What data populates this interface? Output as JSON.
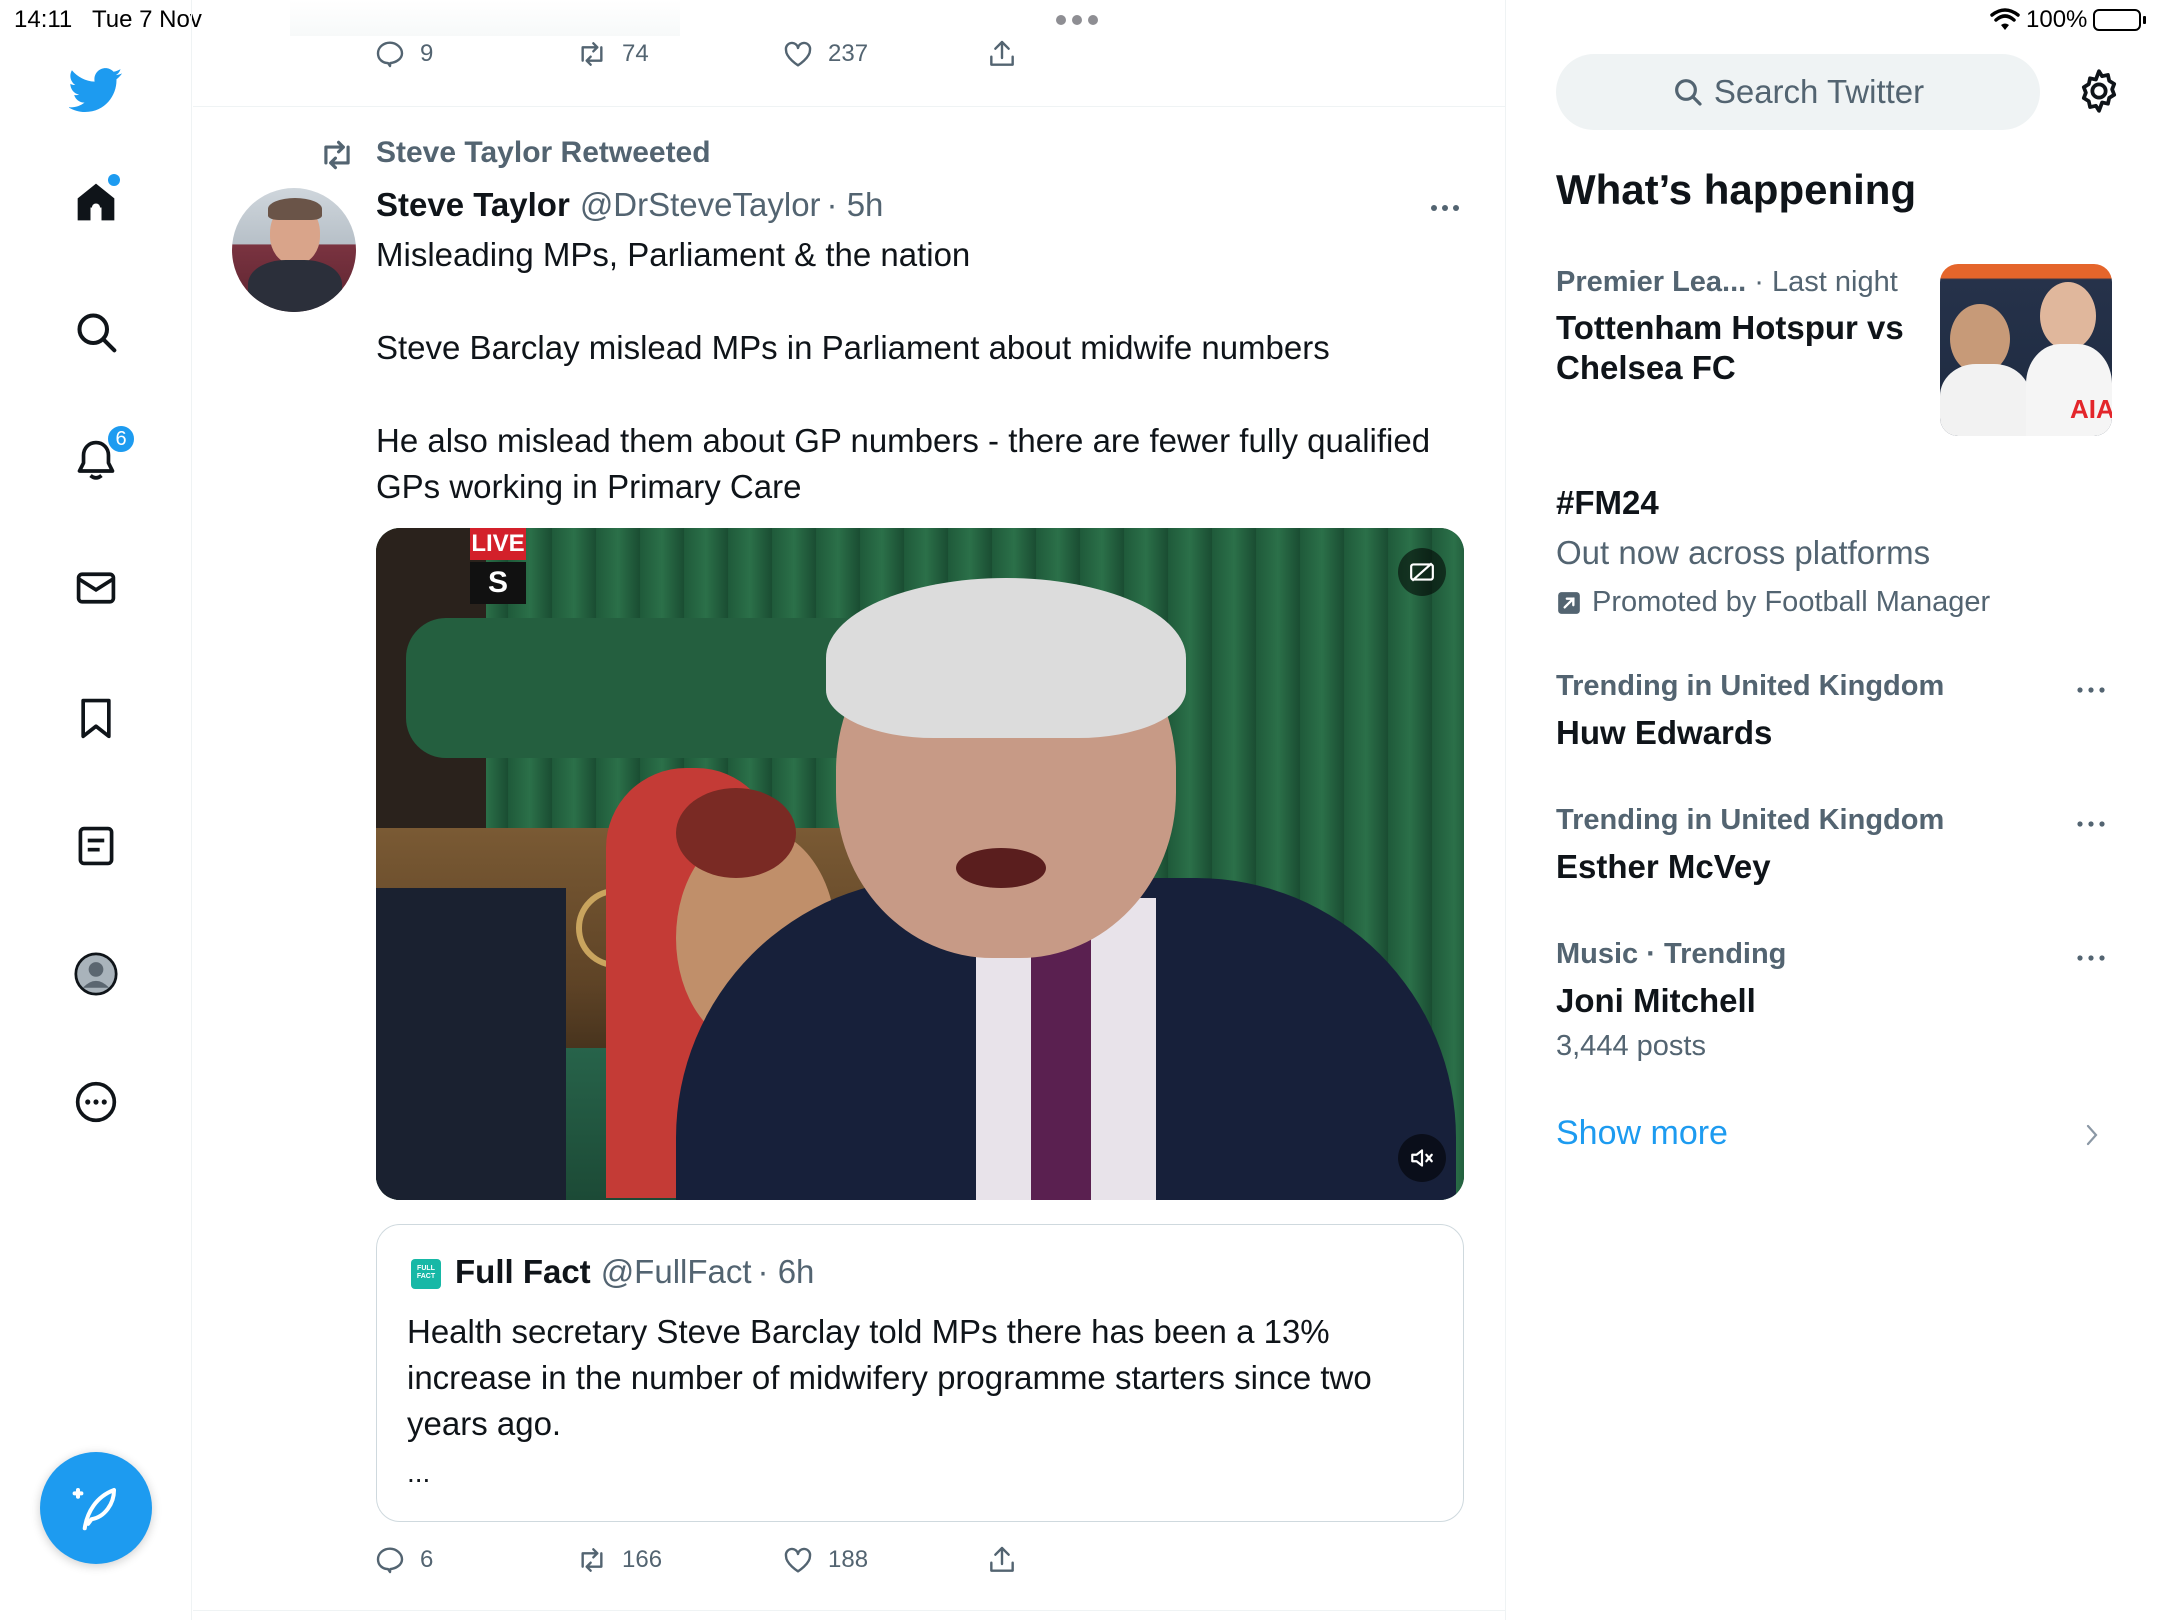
{
  "status_bar": {
    "time": "14:11",
    "date": "Tue 7 Nov",
    "battery": "100%",
    "battery_level": 1.0
  },
  "nav": {
    "notifications_badge": "6",
    "colors": {
      "brand": "#1d9bf0"
    }
  },
  "previous_tweet": {
    "replies": "9",
    "retweets": "74",
    "likes": "237"
  },
  "tweet": {
    "retweeted_by": "Steve Taylor Retweeted",
    "author_name": "Steve Taylor",
    "author_handle": "@DrSteveTaylor",
    "time": "· 5h",
    "paragraphs": [
      "Misleading MPs, Parliament & the nation",
      "Steve Barclay mislead MPs in Parliament about midwife numbers",
      "He also mislead them about GP numbers - there are fewer fully qualified GPs working in Primary Care"
    ],
    "video_live_label": "LIVE",
    "video_channel_label": "S",
    "quote": {
      "author_name": "Full Fact",
      "author_handle": "@FullFact",
      "time": "· 6h",
      "text": "Health secretary Steve Barclay told MPs there has been a 13% increase in the number of midwifery programme starters since two years ago.",
      "ellipsis": "..."
    },
    "replies": "6",
    "retweets": "166",
    "likes": "188"
  },
  "sidebar": {
    "search_placeholder": "Search Twitter",
    "heading": "What’s happening",
    "trends": [
      {
        "meta": "Premier Lea...",
        "meta2": "· Last night",
        "title": "Tottenham Hotspur vs Chelsea FC"
      },
      {
        "meta": "",
        "title": "#FM24",
        "subtitle": "Out now across platforms",
        "promoted": "Promoted by Football Manager"
      },
      {
        "meta": "Trending in United Kingdom",
        "title": "Huw Edwards"
      },
      {
        "meta": "Trending in United Kingdom",
        "title": "Esther McVey"
      },
      {
        "meta": "Music · Trending",
        "title": "Joni Mitchell",
        "subtitle": "3,444 posts"
      }
    ],
    "show_more": "Show more"
  }
}
